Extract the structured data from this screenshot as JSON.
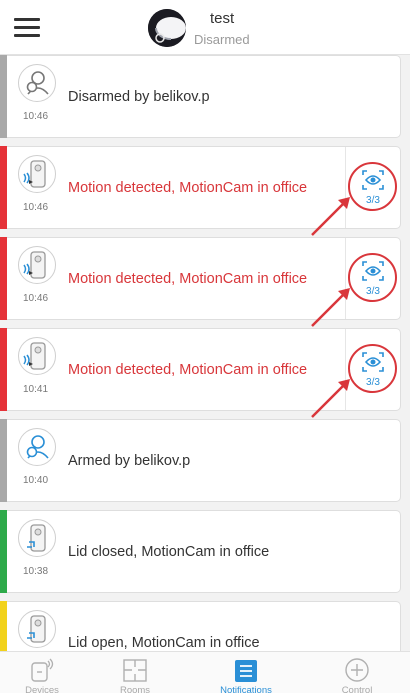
{
  "header": {
    "menu_icon": "hamburger-menu-icon",
    "hub_avatar_icon": "hub-device-icon",
    "hub_name": "test",
    "hub_status": "Disarmed"
  },
  "notifications": [
    {
      "type": "disarm",
      "icon": "disarm-icon",
      "message": "Disarmed by belikov.p",
      "time": "10:46",
      "stripe_color": "#a9a9a9",
      "alarm": false
    },
    {
      "type": "motion",
      "icon": "motioncam-alarm-icon",
      "message": "Motion detected, MotionCam in office",
      "time": "10:46",
      "stripe_color": "#e53238",
      "alarm": true,
      "media_icon": "eye-photo-icon",
      "media_count": "3/3"
    },
    {
      "type": "motion",
      "icon": "motioncam-alarm-icon",
      "message": "Motion detected, MotionCam in office",
      "time": "10:46",
      "stripe_color": "#e53238",
      "alarm": true,
      "media_icon": "eye-photo-icon",
      "media_count": "3/3"
    },
    {
      "type": "motion",
      "icon": "motioncam-alarm-icon",
      "message": "Motion detected, MotionCam in office",
      "time": "10:41",
      "stripe_color": "#e53238",
      "alarm": true,
      "media_icon": "eye-photo-icon",
      "media_count": "3/3"
    },
    {
      "type": "arm",
      "icon": "arm-icon",
      "message": "Armed by belikov.p",
      "time": "10:40",
      "stripe_color": "#a9a9a9",
      "alarm": false
    },
    {
      "type": "lid",
      "icon": "motioncam-lid-icon",
      "message": "Lid closed, MotionCam in office",
      "time": "10:38",
      "stripe_color": "#2eaa4a",
      "alarm": false
    },
    {
      "type": "lid",
      "icon": "motioncam-lid-icon",
      "message": "Lid open, MotionCam in office",
      "time": "",
      "stripe_color": "#f2d21b",
      "alarm": false
    }
  ],
  "bottom_nav": [
    {
      "label": "Devices",
      "icon": "devices-icon",
      "active": false
    },
    {
      "label": "Rooms",
      "icon": "rooms-icon",
      "active": false
    },
    {
      "label": "Notifications",
      "icon": "notifications-icon",
      "active": true
    },
    {
      "label": "Control",
      "icon": "control-icon",
      "active": false
    }
  ],
  "colors": {
    "accent": "#2a8fd6",
    "alarm_text": "#d8363a",
    "highlight": "#d9363b"
  }
}
